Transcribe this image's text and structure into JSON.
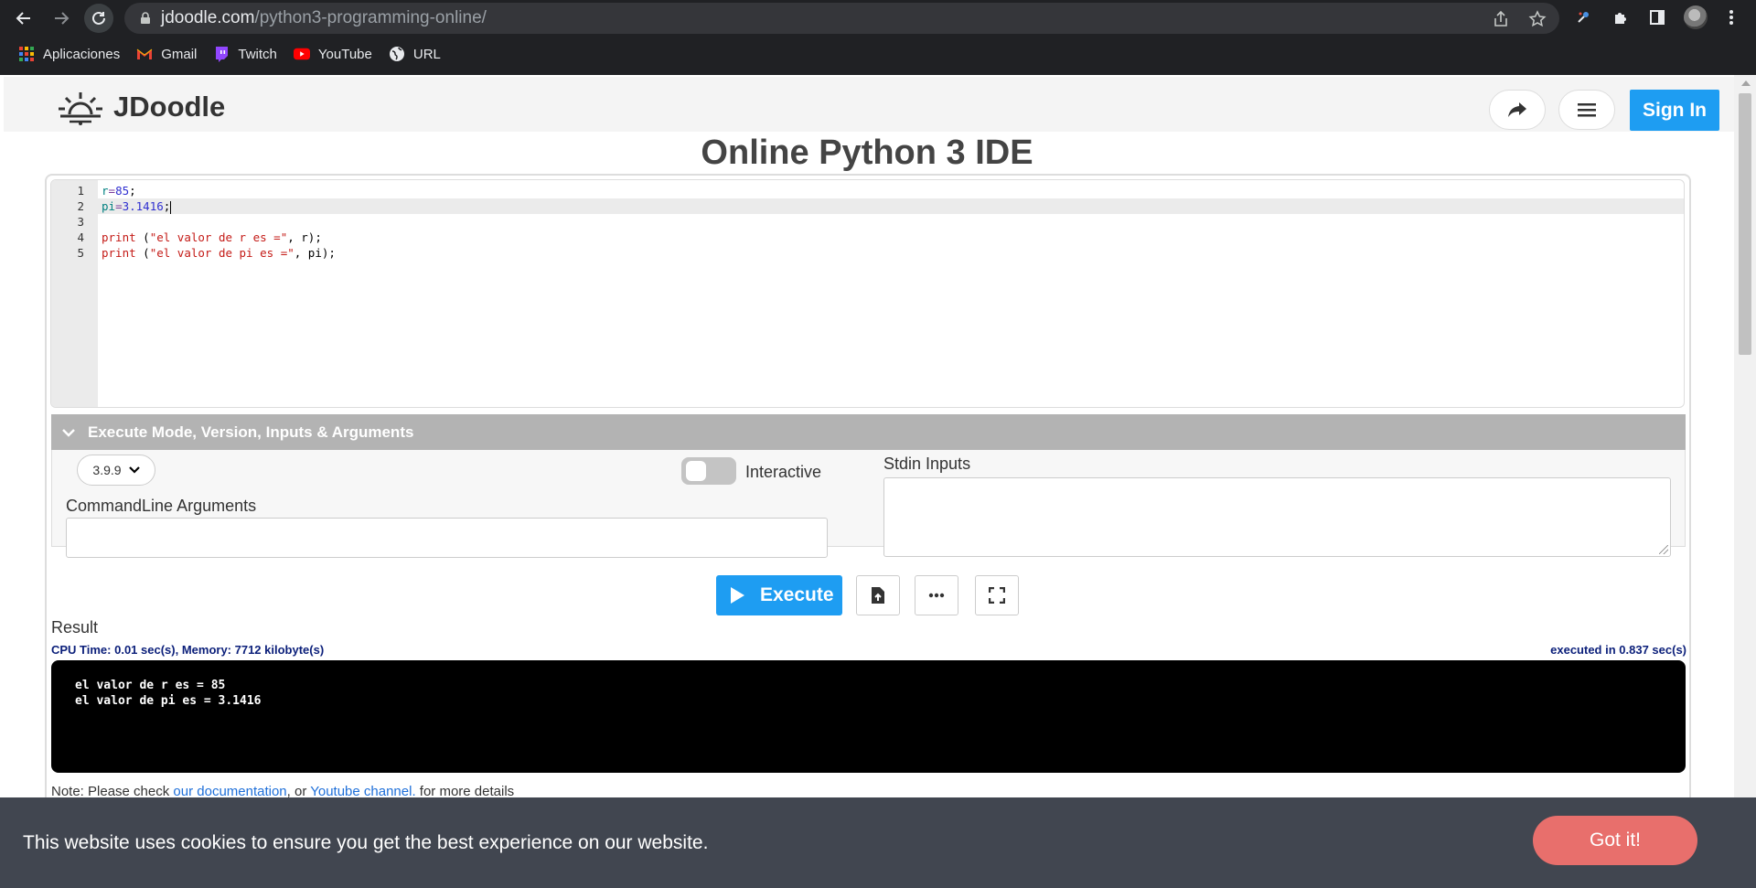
{
  "browser": {
    "url_domain": "jdoodle.com",
    "url_path": "/python3-programming-online/",
    "bookmarks": [
      {
        "label": "Aplicaciones",
        "icon": "apps-grid-icon"
      },
      {
        "label": "Gmail",
        "icon": "gmail-icon"
      },
      {
        "label": "Twitch",
        "icon": "twitch-icon"
      },
      {
        "label": "YouTube",
        "icon": "youtube-icon"
      },
      {
        "label": "URL",
        "icon": "globe-icon"
      }
    ]
  },
  "header": {
    "logo_text": "JDoodle",
    "signin_label": "Sign In"
  },
  "page": {
    "title": "Online Python 3 IDE"
  },
  "editor": {
    "lines": [
      {
        "num": "1",
        "text": "r=85;"
      },
      {
        "num": "2",
        "text": "pi=3.1416;"
      },
      {
        "num": "3",
        "text": ""
      },
      {
        "num": "4",
        "text": "print (\"el valor de r es =\", r);"
      },
      {
        "num": "5",
        "text": "print (\"el valor de pi es =\", pi);"
      }
    ],
    "active_line": 2
  },
  "execute_panel": {
    "header_label": "Execute Mode, Version, Inputs & Arguments",
    "version_value": "3.9.9",
    "interactive_label": "Interactive",
    "interactive_on": false,
    "cmd_label": "CommandLine Arguments",
    "cmd_value": "",
    "stdin_label": "Stdin Inputs",
    "stdin_value": ""
  },
  "actions": {
    "execute_label": "Execute"
  },
  "result": {
    "label": "Result",
    "cpu_memory": "CPU Time: 0.01 sec(s), Memory: 7712 kilobyte(s)",
    "executed_in": "executed in 0.837 sec(s)",
    "output_lines": [
      "el valor de r es = 85",
      "el valor de pi es = 3.1416"
    ]
  },
  "note": {
    "prefix": "Note: Please check ",
    "doc_link": "our documentation",
    "middle": ", or ",
    "yt_link": "Youtube channel.",
    "suffix": " for more details"
  },
  "cookie": {
    "message": "This website uses cookies to ensure you get the best experience on our website.",
    "button_label": "Got it!"
  },
  "colors": {
    "brand_blue": "#1e9df2",
    "cookie_bg": "#414650",
    "cookie_button": "#e86f6c"
  }
}
